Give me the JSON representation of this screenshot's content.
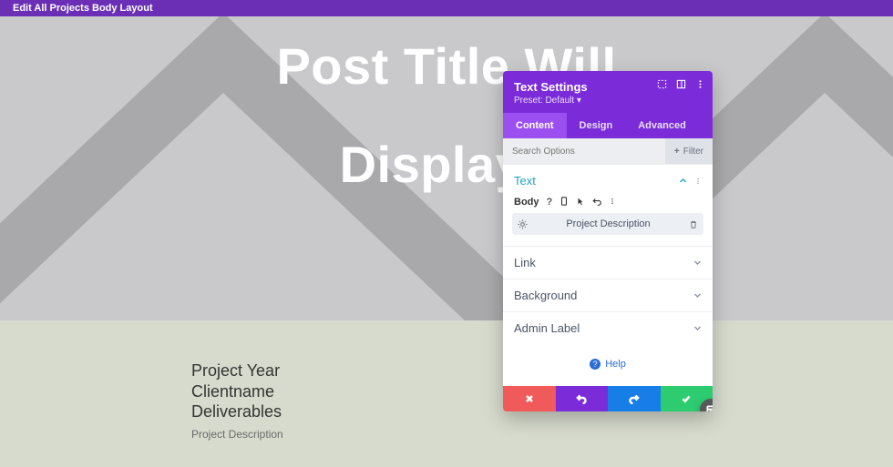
{
  "topbar": {
    "title": "Edit All Projects Body Layout"
  },
  "hero": {
    "line1": "Post Title Will",
    "line2": "Display I"
  },
  "meta": {
    "lines": [
      "Project Year",
      "Clientname",
      "Deliverables"
    ],
    "desc": "Project Description"
  },
  "panel": {
    "title": "Text Settings",
    "preset": "Preset: Default ",
    "tabs": {
      "content": "Content",
      "design": "Design",
      "advanced": "Advanced",
      "active": 0
    },
    "search_placeholder": "Search Options",
    "filter_label": "Filter",
    "sections": {
      "text": "Text",
      "link": "Link",
      "background": "Background",
      "admin": "Admin Label"
    },
    "body_label": "Body",
    "field_value": "Project Description",
    "help": "Help"
  }
}
